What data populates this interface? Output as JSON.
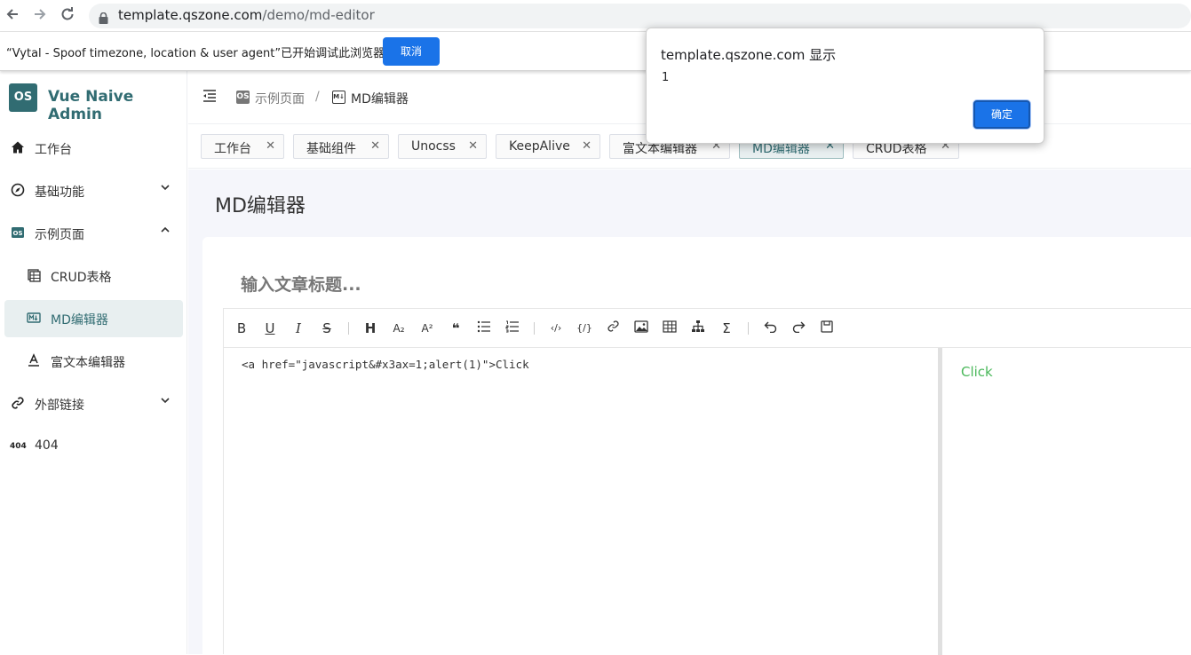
{
  "browser": {
    "url_host": "template.qszone.com",
    "url_path": "/demo/md-editor"
  },
  "debug_bar": {
    "message": "“Vytal - Spoof timezone, location & user agent”已开始调试此浏览器",
    "cancel_label": "取消"
  },
  "sidebar": {
    "logo_text": "OS",
    "brand": "Vue Naive Admin",
    "items": [
      {
        "label": "工作台",
        "icon": "home-icon"
      },
      {
        "label": "基础功能",
        "icon": "compass-icon"
      },
      {
        "label": "示例页面",
        "icon": "os-logo-icon"
      },
      {
        "label": "CRUD表格",
        "icon": "table-icon"
      },
      {
        "label": "MD编辑器",
        "icon": "markdown-icon"
      },
      {
        "label": "富文本编辑器",
        "icon": "text-format-icon"
      },
      {
        "label": "外部链接",
        "icon": "link-icon"
      },
      {
        "label": "404",
        "icon": "404-icon"
      }
    ],
    "icon_404": "404"
  },
  "header": {
    "breadcrumb_parent": "示例页面",
    "breadcrumb_sep": "/",
    "breadcrumb_current": "MD编辑器",
    "crumb_icon_parent": "OS",
    "crumb_icon_current": "M↓"
  },
  "tabs": [
    {
      "label": "工作台"
    },
    {
      "label": "基础组件"
    },
    {
      "label": "Unocss"
    },
    {
      "label": "KeepAlive"
    },
    {
      "label": "富文本编辑器"
    },
    {
      "label": "MD编辑器"
    },
    {
      "label": "CRUD表格"
    }
  ],
  "page": {
    "title": "MD编辑器",
    "article_title_placeholder": "输入文章标题..."
  },
  "editor": {
    "source": "<a href=\"javascript&#x3ax=1;alert(1)\">Click",
    "preview_text": "Click",
    "toolbar_glyphs": {
      "bold": "B",
      "underline": "U",
      "italic": "I",
      "strike": "S",
      "heading": "H",
      "sub": "A₂",
      "sup": "A²",
      "quote": "❝",
      "code_block": "‹/›",
      "inline_code": "{/}",
      "formula": "Σ"
    }
  },
  "dialog": {
    "title": "template.qszone.com 显示",
    "message": "1",
    "ok_label": "确定"
  },
  "colors": {
    "brand": "#316c72",
    "primary_button": "#1a73e8",
    "preview_link": "#4ab85a"
  }
}
